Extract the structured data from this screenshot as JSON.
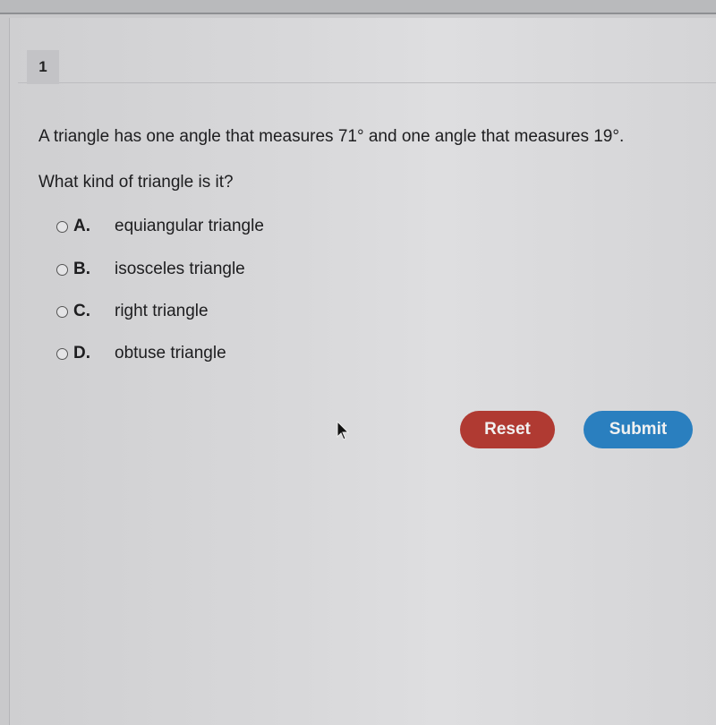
{
  "question_number": "1",
  "question": {
    "stem": "A triangle has one angle that measures 71° and one angle that measures 19°.",
    "prompt": "What kind of triangle is it?"
  },
  "options": [
    {
      "letter": "A.",
      "text": "equiangular triangle"
    },
    {
      "letter": "B.",
      "text": "isosceles triangle"
    },
    {
      "letter": "C.",
      "text": "right triangle"
    },
    {
      "letter": "D.",
      "text": "obtuse triangle"
    }
  ],
  "buttons": {
    "reset_label": "Reset",
    "submit_label": "Submit"
  },
  "colors": {
    "reset": "#b03a32",
    "submit": "#2a7fbf"
  }
}
